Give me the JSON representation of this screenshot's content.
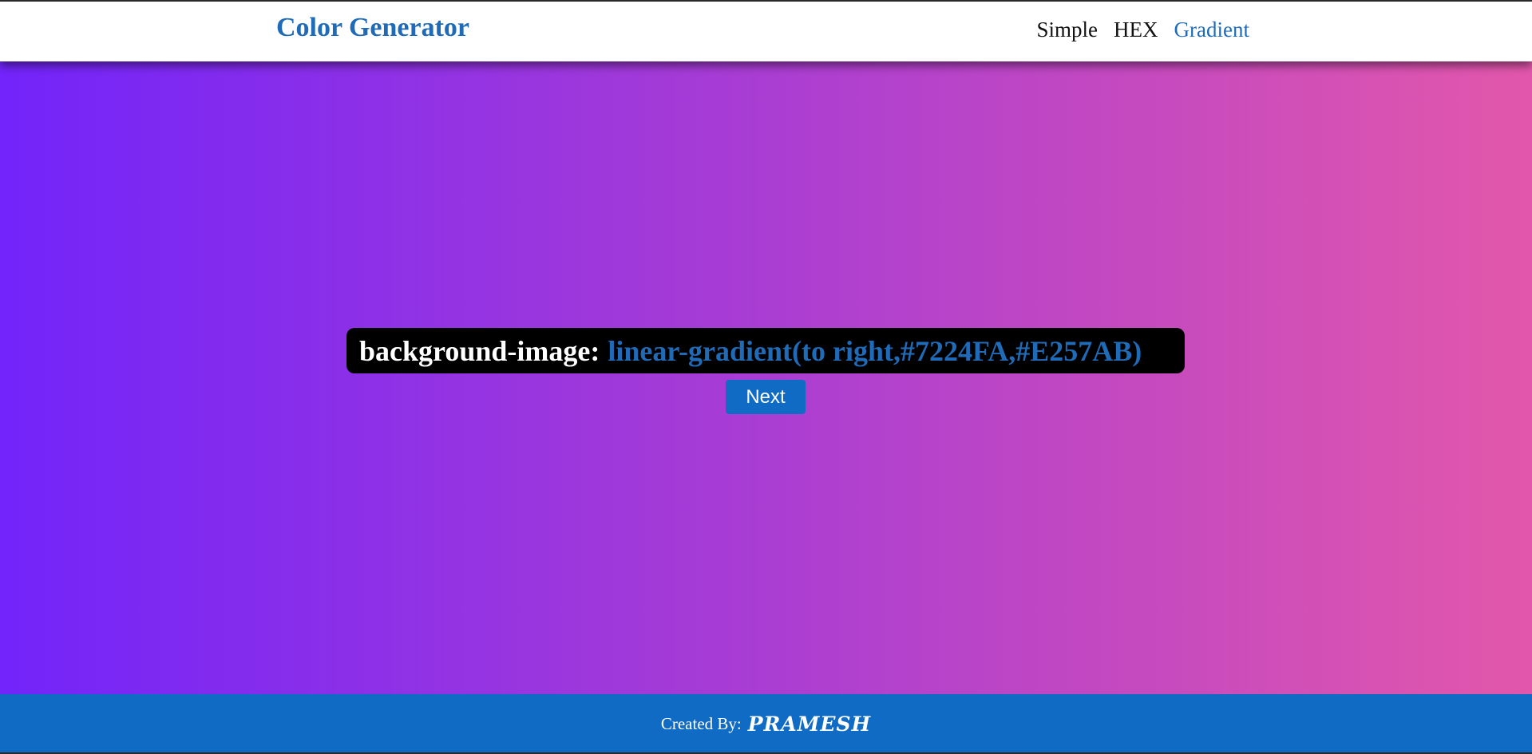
{
  "header": {
    "brand": "Color Generator",
    "nav": [
      {
        "label": "Simple",
        "active": false
      },
      {
        "label": "HEX",
        "active": false
      },
      {
        "label": "Gradient",
        "active": true
      }
    ]
  },
  "main": {
    "property_label": "background-image:",
    "value_text": "linear-gradient(to right,#7224FA,#E257AB)",
    "gradient_start": "#7224FA",
    "gradient_end": "#E257AB",
    "next_button": "Next"
  },
  "footer": {
    "label": "Created By:",
    "name": "PRAMESH"
  },
  "colors": {
    "accent": "#1f6bb8",
    "footer_bg": "#106bc4",
    "code_bg": "#000000"
  }
}
